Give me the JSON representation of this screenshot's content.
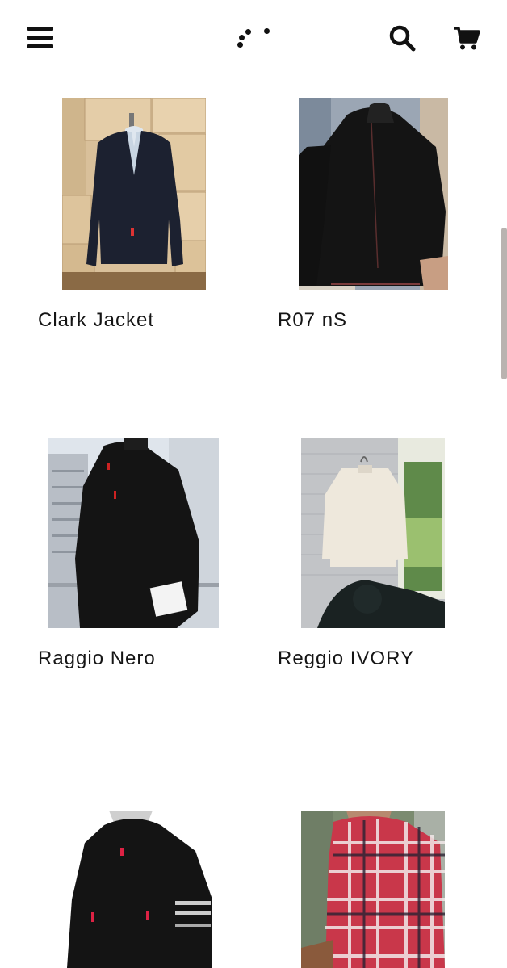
{
  "header": {
    "icons": [
      "menu-icon",
      "logo-dots",
      "search-icon",
      "cart-icon"
    ]
  },
  "products": [
    {
      "title": "Clark Jacket"
    },
    {
      "title": "R07 nS"
    },
    {
      "title": "Raggio Nero"
    },
    {
      "title": "Reggio IVORY"
    },
    {
      "title": ""
    },
    {
      "title": ""
    }
  ],
  "colors": {
    "background": "#ffffff",
    "text": "#151515",
    "scrollbar": "#b9b3b0"
  }
}
